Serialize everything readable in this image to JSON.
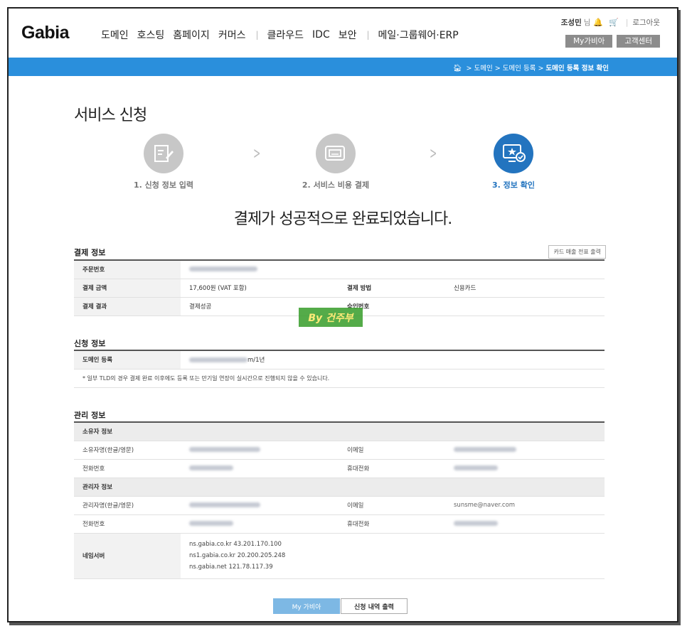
{
  "header": {
    "logo": "Gabia",
    "nav": [
      "도메인",
      "호스팅",
      "홈페이지",
      "커머스",
      "클라우드",
      "IDC",
      "보안",
      "메일·그룹웨어·ERP"
    ],
    "user_name": "조성민",
    "user_suffix": "님",
    "logout": "로그아웃",
    "my_gabia": "My가비아",
    "support": "고객센터"
  },
  "breadcrumb": {
    "items": [
      "도메인",
      "도메인 등록"
    ],
    "current": "도메인 등록 정보 확인"
  },
  "page_title": "서비스 신청",
  "steps": [
    {
      "label": "1. 신청 정보 입력",
      "active": false
    },
    {
      "label": "2. 서비스 비용 결제",
      "active": false
    },
    {
      "label": "3. 정보 확인",
      "active": true
    }
  ],
  "success_message": "결제가 성공적으로 완료되었습니다.",
  "payment": {
    "title": "결제 정보",
    "print_receipt": "카드 매출 전표 출력",
    "order_no_label": "주문번호",
    "amount_label": "결제 금액",
    "amount_value": "17,600원 (VAT 포함)",
    "method_label": "결제 방법",
    "method_value": "신용카드",
    "result_label": "결제 결과",
    "result_value": "결제성공",
    "approval_label": "승인번호"
  },
  "application": {
    "title": "신청 정보",
    "domain_label": "도메인 등록",
    "domain_suffix": "m/1년",
    "note": "* 일부 TLD의 경우 결제 완료 이후에도 등록 또는 만기일 연장이 실시간으로 진행되지 않을 수 있습니다."
  },
  "management": {
    "title": "관리 정보",
    "owner_group": "소유자 정보",
    "owner_name_label": "소유자명(한글/영문)",
    "email_label": "이메일",
    "phone_label": "전화번호",
    "mobile_label": "휴대전화",
    "admin_group": "관리자 정보",
    "admin_name_label": "관리자명(한글/영문)",
    "admin_email": "sunsme@naver.com",
    "nameserver_label": "네임서버",
    "nameservers": [
      "ns.gabia.co.kr 43.201.170.100",
      "ns1.gabia.co.kr 20.200.205.248",
      "ns.gabia.net 121.78.117.39"
    ]
  },
  "buttons": {
    "my_gabia": "My 가비아",
    "print_history": "신청 내역 출력"
  },
  "watermark": "By 건주부",
  "colors": {
    "accent_blue": "#2a8fdc",
    "step_active": "#2374bf",
    "step_inactive": "#c7c7c7",
    "watermark_bg": "#42a236"
  }
}
